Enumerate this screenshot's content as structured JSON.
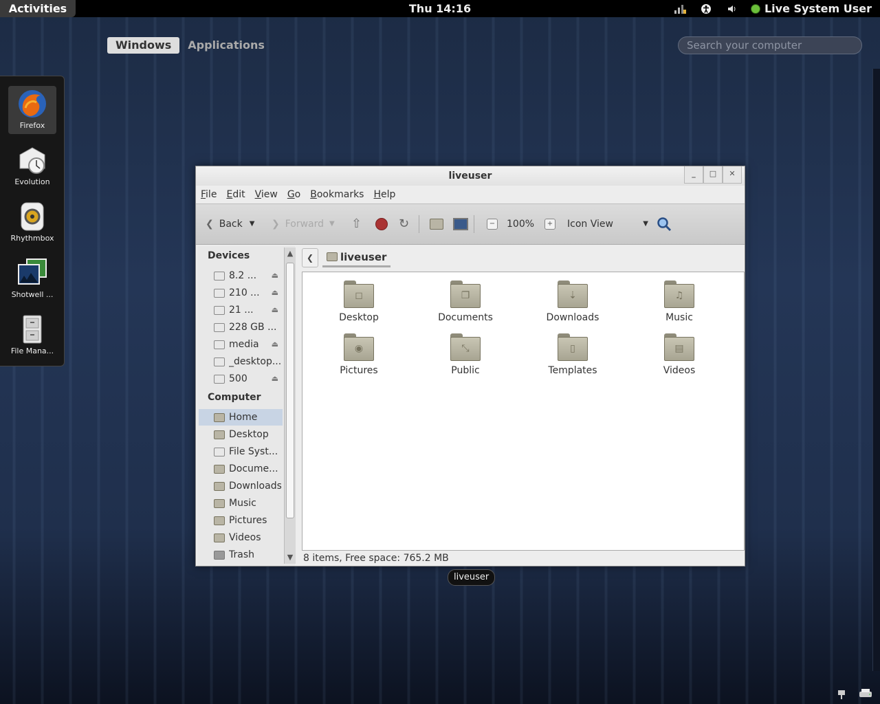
{
  "topbar": {
    "activities": "Activities",
    "clock": "Thu 14:16",
    "tray": [
      {
        "icon": "network-icon",
        "glyph": "▟"
      },
      {
        "icon": "accessibility-icon",
        "glyph": "✪"
      },
      {
        "icon": "volume-icon",
        "glyph": "🔈"
      }
    ],
    "user": "Live System User"
  },
  "overview": {
    "tabs": [
      {
        "label": "Windows",
        "active": true
      },
      {
        "label": "Applications",
        "active": false
      }
    ],
    "search_placeholder": "Search your computer"
  },
  "dash": [
    {
      "label": "Firefox",
      "icon": "firefox-icon",
      "active": true
    },
    {
      "label": "Evolution",
      "icon": "evolution-icon",
      "active": false
    },
    {
      "label": "Rhythmbox",
      "icon": "rhythmbox-icon",
      "active": false
    },
    {
      "label": "Shotwell ...",
      "icon": "shotwell-icon",
      "active": false
    },
    {
      "label": "File Mana...",
      "icon": "file-manager-icon",
      "active": false
    }
  ],
  "window": {
    "title": "liveuser",
    "controls": [
      "_",
      "□",
      "✕"
    ],
    "menu": [
      "File",
      "Edit",
      "View",
      "Go",
      "Bookmarks",
      "Help"
    ],
    "toolbar": {
      "back": "Back",
      "forward": "Forward",
      "zoom": "100%",
      "view_mode": "Icon View"
    },
    "sidebar": {
      "devices_header": "Devices",
      "devices": [
        {
          "label": "8.2 ...",
          "eject": true,
          "type": "drive"
        },
        {
          "label": "210 ...",
          "eject": true,
          "type": "drive"
        },
        {
          "label": "21 ...",
          "eject": true,
          "type": "drive"
        },
        {
          "label": "228 GB ...",
          "eject": false,
          "type": "drive"
        },
        {
          "label": "media",
          "eject": true,
          "type": "drive"
        },
        {
          "label": "_desktop...",
          "eject": false,
          "type": "drive"
        },
        {
          "label": "500",
          "eject": true,
          "type": "drive"
        }
      ],
      "computer_header": "Computer",
      "computer": [
        {
          "label": "Home",
          "selected": true
        },
        {
          "label": "Desktop",
          "selected": false
        },
        {
          "label": "File Syst...",
          "selected": false
        },
        {
          "label": "Docume...",
          "selected": false
        },
        {
          "label": "Downloads",
          "selected": false
        },
        {
          "label": "Music",
          "selected": false
        },
        {
          "label": "Pictures",
          "selected": false
        },
        {
          "label": "Videos",
          "selected": false
        },
        {
          "label": "Trash",
          "selected": false
        }
      ]
    },
    "path": "liveuser",
    "files": [
      {
        "label": "Desktop",
        "emblem": "◻"
      },
      {
        "label": "Documents",
        "emblem": "❐"
      },
      {
        "label": "Downloads",
        "emblem": "⇣"
      },
      {
        "label": "Music",
        "emblem": "♫"
      },
      {
        "label": "Pictures",
        "emblem": "◉"
      },
      {
        "label": "Public",
        "emblem": "⤡"
      },
      {
        "label": "Templates",
        "emblem": "▯"
      },
      {
        "label": "Videos",
        "emblem": "▤"
      }
    ],
    "status": "8 items, Free space: 765.2 MB"
  },
  "window_label": "liveuser"
}
